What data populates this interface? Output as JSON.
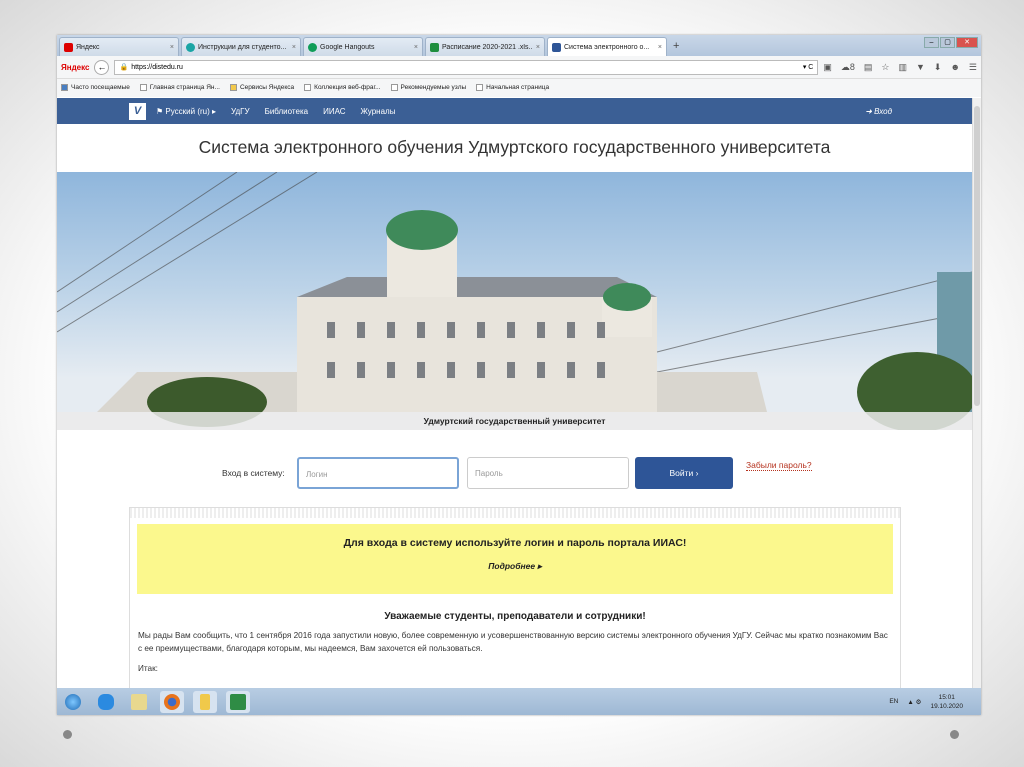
{
  "browser": {
    "tabs": [
      {
        "label": "Яндекс",
        "color": "#d00"
      },
      {
        "label": "Инструкции для студенто...",
        "color": "#1aa5a5"
      },
      {
        "label": "Google Hangouts",
        "color": "#0f9d58"
      },
      {
        "label": "Расписание 2020-2021 .xls...",
        "color": "#1e8e3e"
      },
      {
        "label": "Система электронного о...",
        "color": "#2e5597",
        "active": true
      }
    ],
    "new_tab": "+",
    "brand": "Яндекс",
    "url": "https://distedu.ru",
    "badge_count": "8",
    "bookmarks": [
      "Часто посещаемые",
      "Главная страница Ян...",
      "Сервисы Яндекса",
      "Коллекция веб-фраг...",
      "Рекомендуемые узлы",
      "Начальная страница"
    ]
  },
  "site": {
    "logo": "V",
    "language": "Русский (ru)",
    "nav": [
      "УдГУ",
      "Библиотека",
      "ИИАС",
      "Журналы"
    ],
    "login_link": "Вход",
    "title": "Система электронного обучения Удмуртского государственного университета",
    "banner_caption": "Удмуртский государственный университет",
    "login_label": "Вход в систему:",
    "login_placeholder": "Логин",
    "password_placeholder": "Пароль",
    "login_button": "Войти ›",
    "forgot": "Забыли пароль?",
    "notice": "Для входа в систему используйте логин и пароль портала ИИАС!",
    "more": "Подробнее ▸",
    "welcome": "Уважаемые студенты, преподаватели и сотрудники!",
    "paragraph": "Мы рады Вам сообщить, что 1 сентября 2016 года запустили новую, более современную и усовершенствованную версию системы электронного обучения УдГУ. Сейчас мы кратко познакомим Вас с ее преимуществами, благодаря которым, мы надеемся, Вам захочется ей пользоваться.",
    "itak": "Итак:"
  },
  "taskbar": {
    "lang": "EN",
    "time": "15:01",
    "date": "19.10.2020"
  }
}
